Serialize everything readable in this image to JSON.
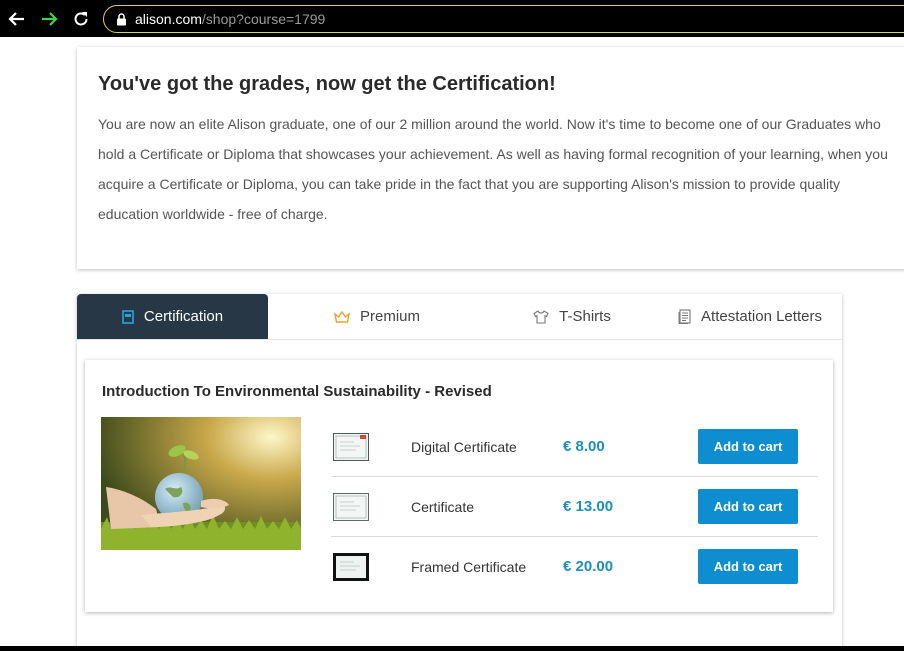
{
  "browser": {
    "url_host": "alison.com",
    "url_path": "/shop?course=1799"
  },
  "intro": {
    "title": "You've got the grades, now get the Certification!",
    "text": "You are now an elite Alison graduate, one of our 2 million around the world. Now it's time to become one of our Graduates who hold a Certificate or Diploma that showcases your achievement. As well as having formal recognition of your learning, when you acquire a Certificate or Diploma, you can take pride in the fact that you are supporting Alison's mission to provide quality education worldwide - free of charge."
  },
  "tabs": [
    {
      "label": "Certification",
      "icon": "certificate-icon",
      "active": true
    },
    {
      "label": "Premium",
      "icon": "crown-icon",
      "active": false
    },
    {
      "label": "T-Shirts",
      "icon": "tshirt-icon",
      "active": false
    },
    {
      "label": "Attestation Letters",
      "icon": "document-icon",
      "active": false
    }
  ],
  "course": {
    "title": "Introduction To Environmental Sustainability - Revised",
    "items": [
      {
        "name": "Digital Certificate",
        "price": "€ 8.00",
        "button": "Add to cart"
      },
      {
        "name": "Certificate",
        "price": "€ 13.00",
        "button": "Add to cart"
      },
      {
        "name": "Framed Certificate",
        "price": "€ 20.00",
        "button": "Add to cart"
      }
    ]
  },
  "colors": {
    "accent": "#0e8ed0",
    "price": "#1b8ec5",
    "active_tab": "#283745"
  }
}
